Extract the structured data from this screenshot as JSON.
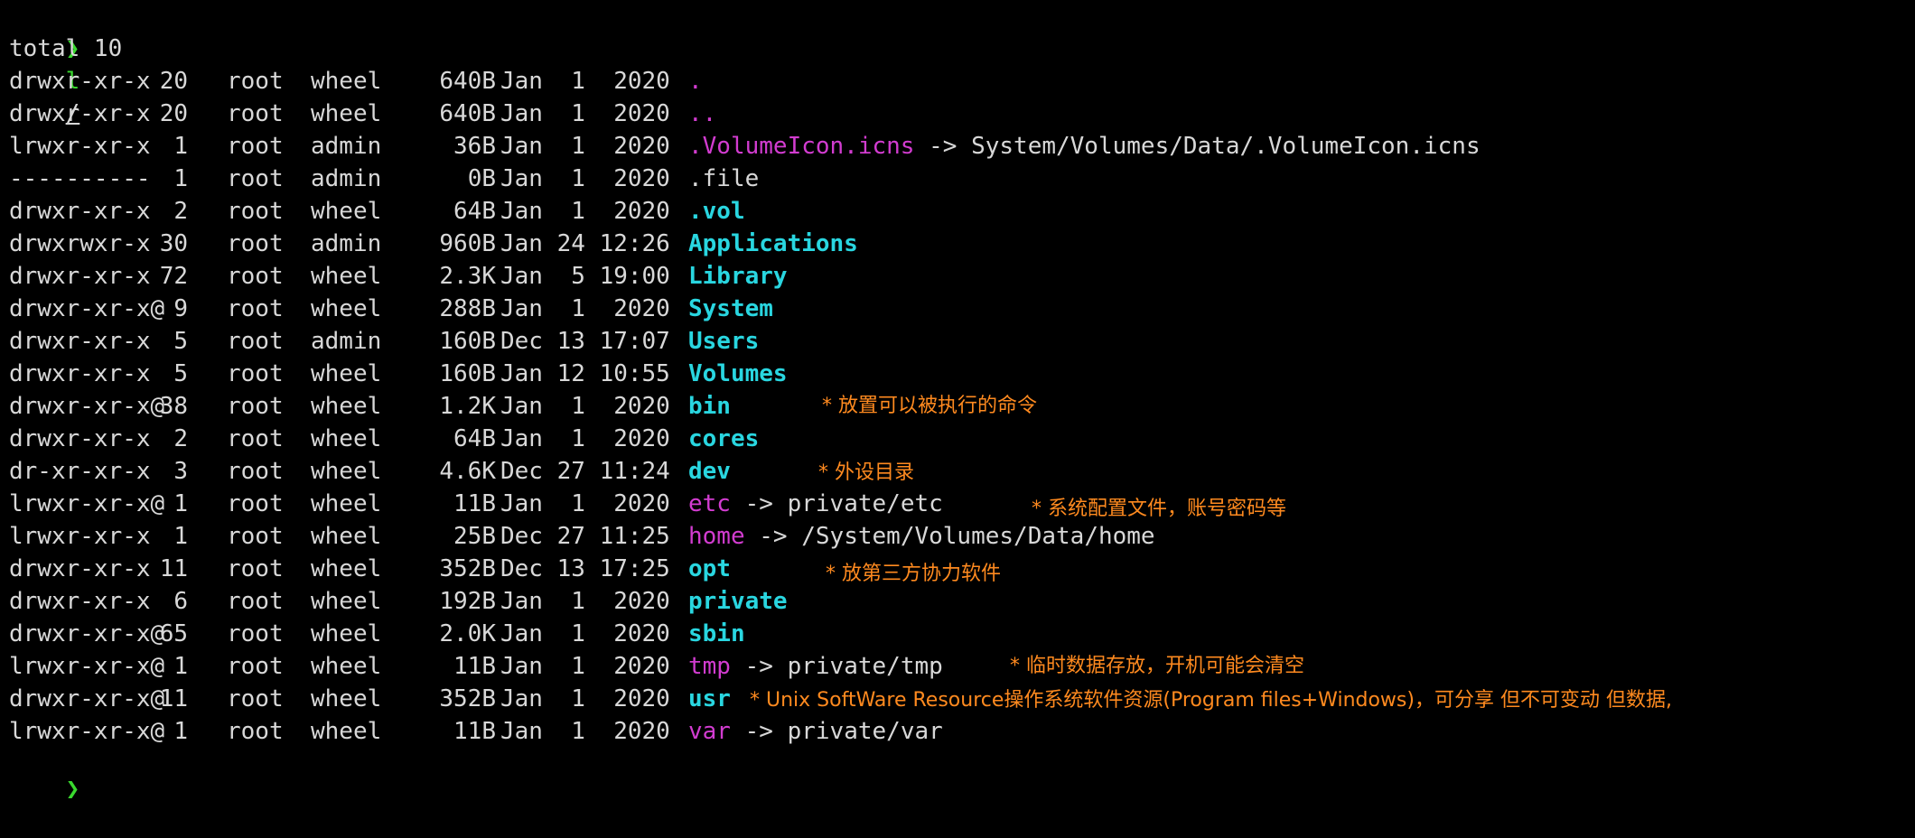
{
  "prompt": {
    "symbol": "❯",
    "command": "l",
    "argument": "/"
  },
  "total_line": "total 10",
  "entries": [
    {
      "perms": "drwxr-xr-x",
      "links": "20",
      "owner": "root",
      "group": "wheel",
      "size": "640B",
      "date": "Jan  1  2020",
      "name": ".",
      "target": "",
      "type": "hidden-dot"
    },
    {
      "perms": "drwxr-xr-x",
      "links": "20",
      "owner": "root",
      "group": "wheel",
      "size": "640B",
      "date": "Jan  1  2020",
      "name": "..",
      "target": "",
      "type": "hidden-dot"
    },
    {
      "perms": "lrwxr-xr-x",
      "links": "1",
      "owner": "root",
      "group": "admin",
      "size": "36B",
      "date": "Jan  1  2020",
      "name": ".VolumeIcon.icns",
      "target": "System/Volumes/Data/.VolumeIcon.icns",
      "type": "link"
    },
    {
      "perms": "----------",
      "links": "1",
      "owner": "root",
      "group": "admin",
      "size": "0B",
      "date": "Jan  1  2020",
      "name": ".file",
      "target": "",
      "type": "file"
    },
    {
      "perms": "drwxr-xr-x",
      "links": "2",
      "owner": "root",
      "group": "wheel",
      "size": "64B",
      "date": "Jan  1  2020",
      "name": ".vol",
      "target": "",
      "type": "dir"
    },
    {
      "perms": "drwxrwxr-x",
      "links": "30",
      "owner": "root",
      "group": "admin",
      "size": "960B",
      "date": "Jan 24 12:26",
      "name": "Applications",
      "target": "",
      "type": "dir"
    },
    {
      "perms": "drwxr-xr-x",
      "links": "72",
      "owner": "root",
      "group": "wheel",
      "size": "2.3K",
      "date": "Jan  5 19:00",
      "name": "Library",
      "target": "",
      "type": "dir"
    },
    {
      "perms": "drwxr-xr-x@",
      "links": "9",
      "owner": "root",
      "group": "wheel",
      "size": "288B",
      "date": "Jan  1  2020",
      "name": "System",
      "target": "",
      "type": "dir"
    },
    {
      "perms": "drwxr-xr-x",
      "links": "5",
      "owner": "root",
      "group": "admin",
      "size": "160B",
      "date": "Dec 13 17:07",
      "name": "Users",
      "target": "",
      "type": "dir"
    },
    {
      "perms": "drwxr-xr-x",
      "links": "5",
      "owner": "root",
      "group": "wheel",
      "size": "160B",
      "date": "Jan 12 10:55",
      "name": "Volumes",
      "target": "",
      "type": "dir"
    },
    {
      "perms": "drwxr-xr-x@",
      "links": "38",
      "owner": "root",
      "group": "wheel",
      "size": "1.2K",
      "date": "Jan  1  2020",
      "name": "bin",
      "target": "",
      "type": "dir"
    },
    {
      "perms": "drwxr-xr-x",
      "links": "2",
      "owner": "root",
      "group": "wheel",
      "size": "64B",
      "date": "Jan  1  2020",
      "name": "cores",
      "target": "",
      "type": "dir"
    },
    {
      "perms": "dr-xr-xr-x",
      "links": "3",
      "owner": "root",
      "group": "wheel",
      "size": "4.6K",
      "date": "Dec 27 11:24",
      "name": "dev",
      "target": "",
      "type": "dir"
    },
    {
      "perms": "lrwxr-xr-x@",
      "links": "1",
      "owner": "root",
      "group": "wheel",
      "size": "11B",
      "date": "Jan  1  2020",
      "name": "etc",
      "target": "private/etc",
      "type": "link"
    },
    {
      "perms": "lrwxr-xr-x",
      "links": "1",
      "owner": "root",
      "group": "wheel",
      "size": "25B",
      "date": "Dec 27 11:25",
      "name": "home",
      "target": "/System/Volumes/Data/home",
      "type": "link"
    },
    {
      "perms": "drwxr-xr-x",
      "links": "11",
      "owner": "root",
      "group": "wheel",
      "size": "352B",
      "date": "Dec 13 17:25",
      "name": "opt",
      "target": "",
      "type": "dir"
    },
    {
      "perms": "drwxr-xr-x",
      "links": "6",
      "owner": "root",
      "group": "wheel",
      "size": "192B",
      "date": "Jan  1  2020",
      "name": "private",
      "target": "",
      "type": "dir"
    },
    {
      "perms": "drwxr-xr-x@",
      "links": "65",
      "owner": "root",
      "group": "wheel",
      "size": "2.0K",
      "date": "Jan  1  2020",
      "name": "sbin",
      "target": "",
      "type": "dir"
    },
    {
      "perms": "lrwxr-xr-x@",
      "links": "1",
      "owner": "root",
      "group": "wheel",
      "size": "11B",
      "date": "Jan  1  2020",
      "name": "tmp",
      "target": "private/tmp",
      "type": "link"
    },
    {
      "perms": "drwxr-xr-x@",
      "links": "11",
      "owner": "root",
      "group": "wheel",
      "size": "352B",
      "date": "Jan  1  2020",
      "name": "usr",
      "target": "",
      "type": "dir"
    },
    {
      "perms": "lrwxr-xr-x@",
      "links": "1",
      "owner": "root",
      "group": "wheel",
      "size": "11B",
      "date": "Jan  1  2020",
      "name": "var",
      "target": "private/var",
      "type": "link"
    }
  ],
  "annotations": {
    "bin": "* 放置可以被执行的命令",
    "dev": "* 外设目录",
    "etc": "* 系统配置文件，账号密码等",
    "opt": "* 放第三方协力软件",
    "tmp": "* 临时数据存放，开机可能会清空",
    "usr": "* Unix SoftWare Resource操作系统软件资源(Program files+Windows)，可分享 但不可变动 但数据,"
  },
  "arrow": "->",
  "colors": {
    "background": "#000000",
    "text": "#d8d8d8",
    "directory": "#29d6e0",
    "symlink": "#d23cd0",
    "prompt": "#39d82e",
    "annotation": "#ff8a1f"
  }
}
